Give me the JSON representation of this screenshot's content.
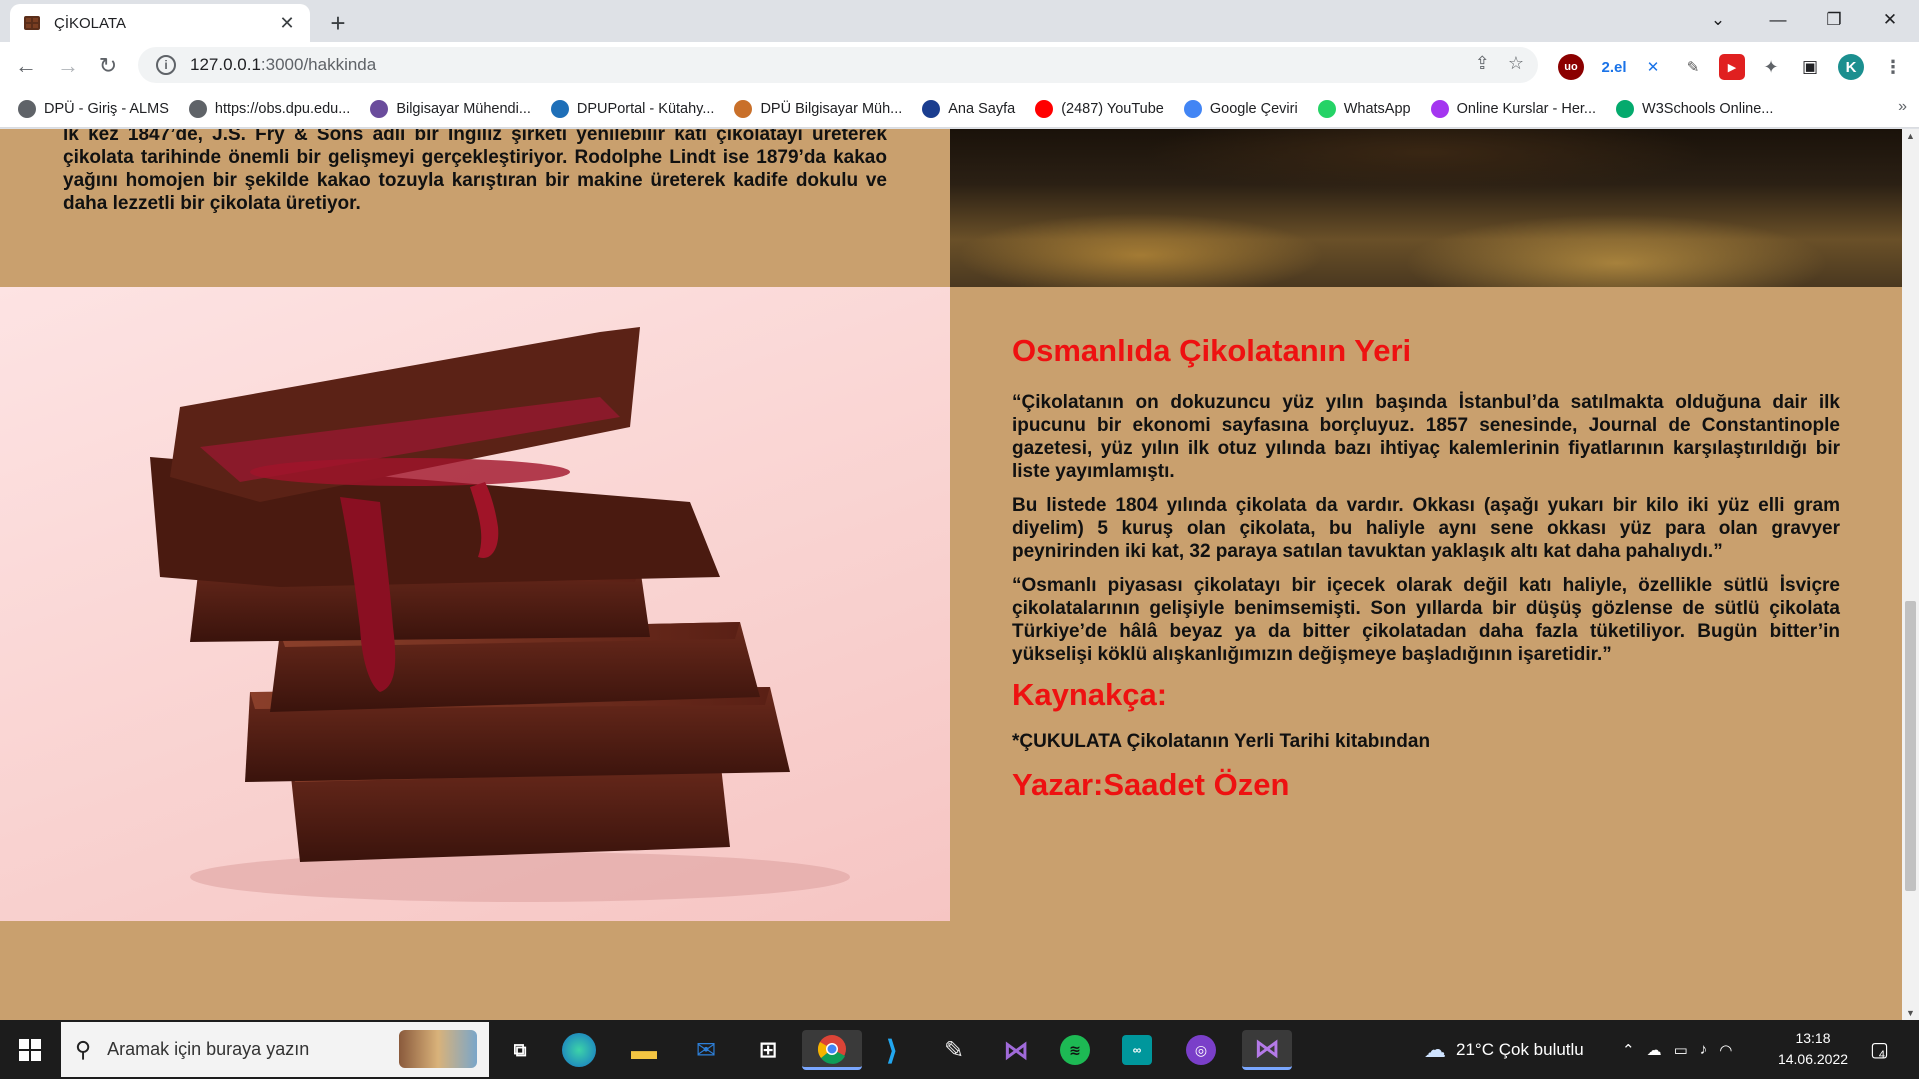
{
  "browser": {
    "tab_title": "ÇİKOLATA",
    "url_host": "127.0.0.1",
    "url_path": ":3000/hakkinda",
    "profile_initial": "K",
    "ext_2el": "2.el",
    "bookmarks": [
      {
        "label": "DPÜ - Giriş - ALMS",
        "icon": "globe-icon",
        "color": "#5f6368"
      },
      {
        "label": "https://obs.dpu.edu...",
        "icon": "globe-icon",
        "color": "#5f6368"
      },
      {
        "label": "Bilgisayar Mühendi...",
        "icon": "info-circle-icon",
        "color": "#6a4c9c"
      },
      {
        "label": "DPUPortal - Kütahy...",
        "icon": "dpu-portal-icon",
        "color": "#1e6fb8"
      },
      {
        "label": "DPÜ Bilgisayar Müh...",
        "icon": "dpu-logo-icon",
        "color": "#c9702a"
      },
      {
        "label": "Ana Sayfa",
        "icon": "btk-logo-icon",
        "color": "#1a3d8f"
      },
      {
        "label": "(2487) YouTube",
        "icon": "youtube-icon",
        "color": "#ff0000"
      },
      {
        "label": "Google Çeviri",
        "icon": "google-translate-icon",
        "color": "#4285f4"
      },
      {
        "label": "WhatsApp",
        "icon": "whatsapp-icon",
        "color": "#25d366"
      },
      {
        "label": "Online Kurslar - Her...",
        "icon": "udemy-icon",
        "color": "#a435f0"
      },
      {
        "label": "W3Schools Online...",
        "icon": "w3schools-icon",
        "color": "#04aa6d"
      }
    ]
  },
  "page": {
    "intro_text": "lk kez 1847’de, J.S. Fry & Sons adlı bir İngiliz şirketi yenilebilir katı çikolatayı üreterek çikolata tarihinde önemli bir gelişmeyi gerçekleştiriyor. Rodolphe Lindt ise 1879’da kakao yağını homojen bir şekilde kakao tozuyla karıştıran bir makine üreterek kadife dokulu ve daha lezzetli bir çikolata üretiyor.",
    "ottoman_heading": "Osmanlıda Çikolatanın Yeri",
    "paragraphs": [
      "“Çikolatanın on dokuzuncu yüz yılın başında İstanbul’da satılmakta olduğuna dair ilk ipucunu bir ekonomi sayfasına borçluyuz. 1857 senesinde, Journal de Constantinople gazetesi, yüz yılın ilk otuz yılında bazı ihtiyaç kalemlerinin fiyatlarının karşılaştırıldığı bir liste yayımlamıştı.",
      "Bu listede 1804 yılında çikolata da vardır. Okkası (aşağı yukarı bir kilo iki yüz elli gram diyelim) 5 kuruş olan çikolata, bu haliyle aynı sene okkası yüz para olan gravyer peynirinden iki kat, 32 paraya satılan tavuktan yaklaşık altı kat daha pahalıydı.”",
      "“Osmanlı piyasası çikolatayı bir içecek olarak değil katı haliyle, özellikle sütlü İsviçre çikolatalarının gelişiyle benimsemişti. Son yıllarda bir düşüş gözlense de sütlü çikolata Türkiye’de hâlâ beyaz ya da bitter çikolatadan daha fazla tüketiliyor. Bugün bitter’in yükselişi köklü alışkanlığımızın değişmeye başladığının işaretidir.”"
    ],
    "sources_heading": "Kaynakça:",
    "source_text": "*ÇUKULATA Çikolatanın Yerli Tarihi kitabından",
    "author": "Yazar:Saadet Özen"
  },
  "taskbar": {
    "search_placeholder": "Aramak için buraya yazın",
    "weather": "21°C  Çok bulutlu",
    "time": "13:18",
    "date": "14.06.2022",
    "notification_count": "4"
  },
  "colors": {
    "page_bg": "#c9a06e",
    "heading_red": "#ee1111"
  }
}
